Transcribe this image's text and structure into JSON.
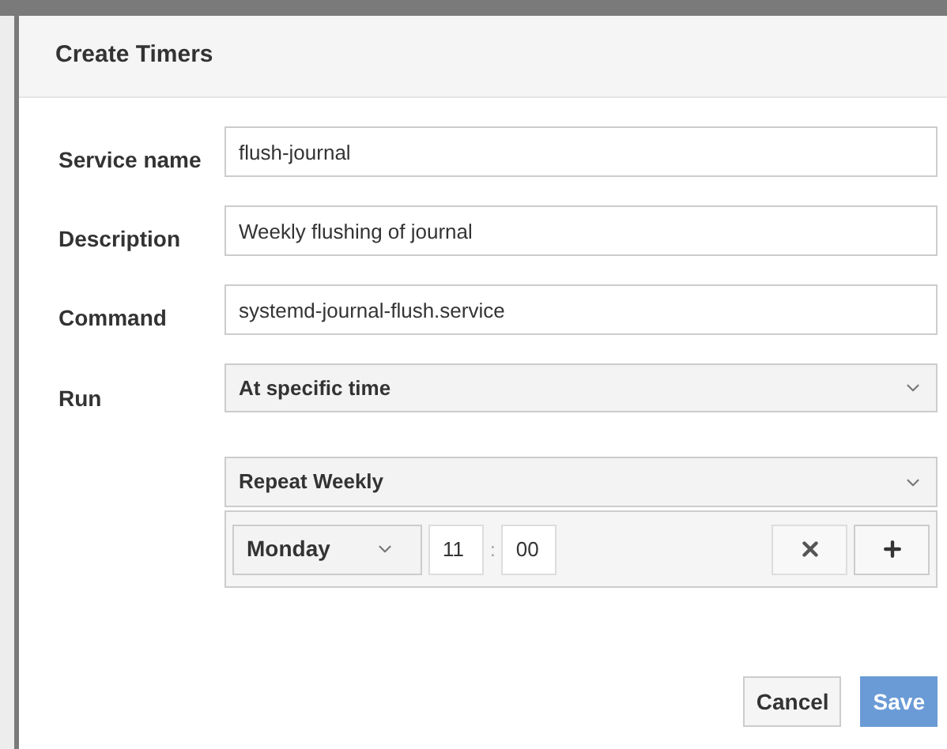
{
  "dialog": {
    "title": "Create Timers"
  },
  "fields": [
    {
      "label": "Service name",
      "value": "flush-journal"
    },
    {
      "label": "Description",
      "value": "Weekly flushing of journal"
    },
    {
      "label": "Command",
      "value": "systemd-journal-flush.service"
    }
  ],
  "run": {
    "label": "Run",
    "value": "At specific time"
  },
  "repeat": {
    "value": "Repeat Weekly",
    "day": "Monday",
    "hour": "11",
    "separator": ":",
    "minute": "00"
  },
  "buttons": [
    {
      "label": "Cancel",
      "kind": "default"
    },
    {
      "label": "Save",
      "kind": "primary"
    }
  ]
}
